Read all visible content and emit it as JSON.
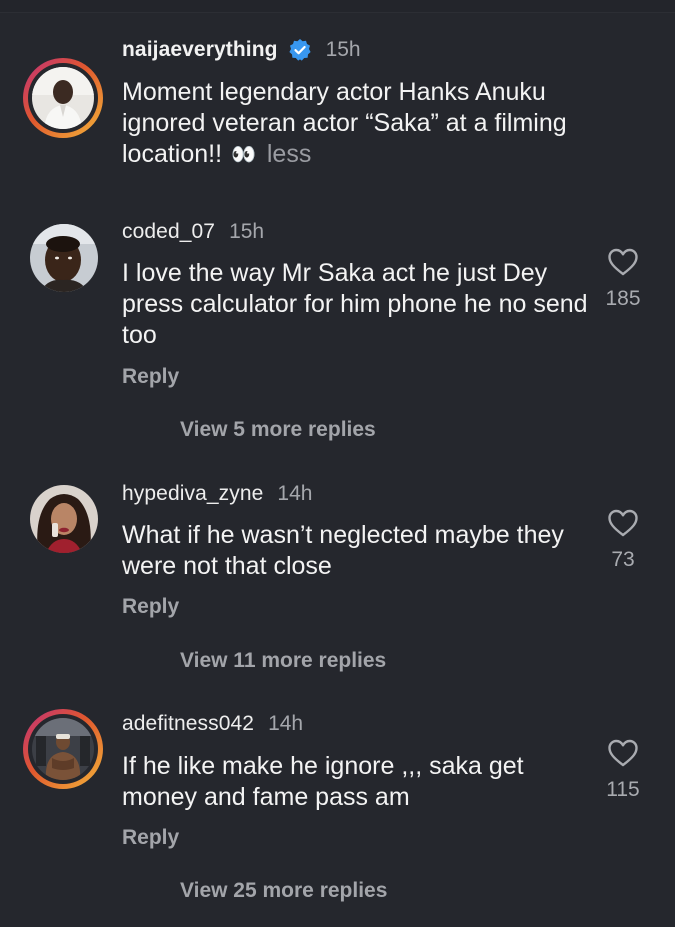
{
  "post": {
    "username": "naijaeverything",
    "time": "15h",
    "verified": true,
    "caption": "Moment legendary actor Hanks Anuku ignored veteran actor “Saka” at a filming location!!",
    "eyes_emoji": "👀",
    "less_label": "less"
  },
  "comments": [
    {
      "username": "coded_07",
      "time": "15h",
      "text": "I love the way Mr Saka act he just Dey press calculator for him phone he no send too",
      "reply_label": "Reply",
      "view_replies": "View 5 more replies",
      "likes": "185"
    },
    {
      "username": "hypediva_zyne",
      "time": "14h",
      "text": "What if he wasn’t neglected maybe they were not that close",
      "reply_label": "Reply",
      "view_replies": "View 11 more replies",
      "likes": "73"
    },
    {
      "username": "adefitness042",
      "time": "14h",
      "text": "If he like make he ignore ,,, saka get money and fame pass am",
      "reply_label": "Reply",
      "view_replies": "View 25 more replies",
      "likes": "115"
    }
  ],
  "icons": {
    "verified": "verified-badge-icon",
    "like": "heart-icon"
  },
  "colors": {
    "background": "#25272d",
    "verified_blue": "#3897f0",
    "muted_text": "#a3a5aa",
    "story_ring_start": "#c0307a",
    "story_ring_end": "#f4b63a"
  }
}
